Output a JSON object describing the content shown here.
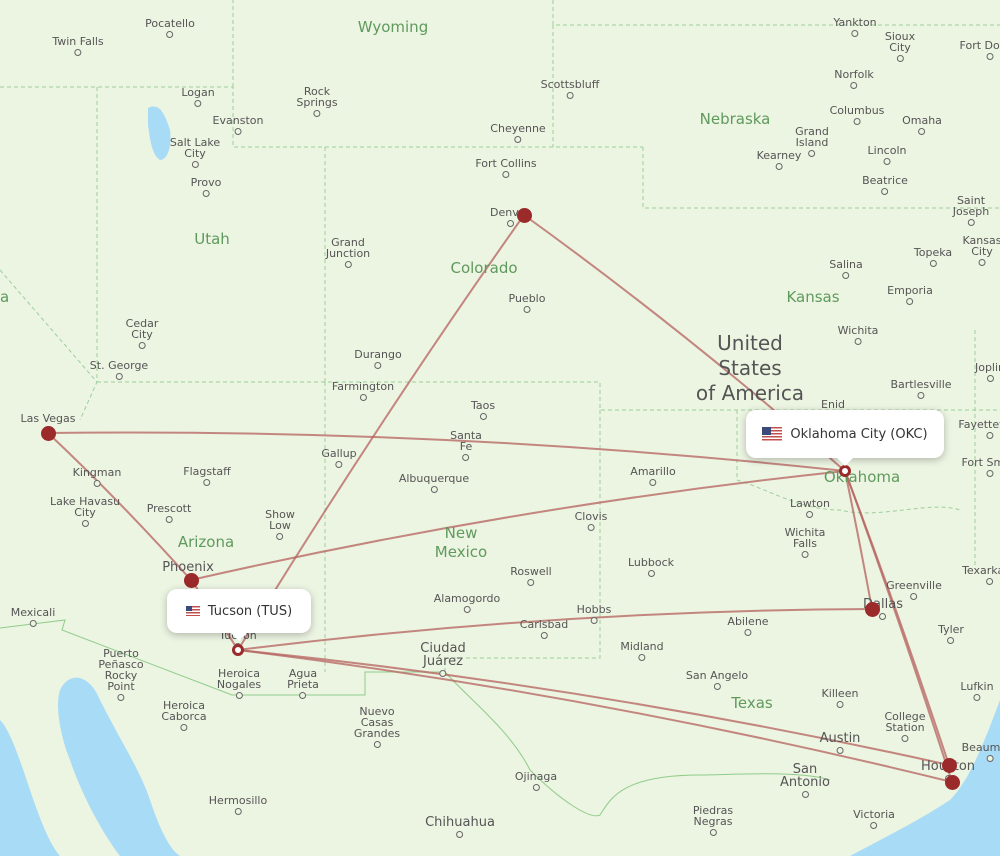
{
  "map": {
    "country_label": [
      "United",
      "States",
      "of America"
    ],
    "state_labels": [
      "Wyoming",
      "Nebraska",
      "Utah",
      "Colorado",
      "Kansas",
      "Arizona",
      "New Mexico",
      "Oklahoma",
      "Texas",
      "Nevada"
    ],
    "cities": [
      "Pocatello",
      "Twin Falls",
      "Logan",
      "Rock Springs",
      "Evanston",
      "Salt Lake City",
      "Provo",
      "Scottsbluff",
      "Cheyenne",
      "Fort Collins",
      "Denver",
      "Yankton",
      "Sioux City",
      "Fort Dodge",
      "Norfolk",
      "Columbus",
      "Omaha",
      "Grand Island",
      "Kearney",
      "Lincoln",
      "Beatrice",
      "Saint Joseph",
      "Kansas City",
      "Topeka",
      "Salina",
      "Emporia",
      "Wichita",
      "Grand Junction",
      "Pueblo",
      "Cedar City",
      "St. George",
      "Durango",
      "Farmington",
      "Taos",
      "Santa Fe",
      "Gallup",
      "Albuquerque",
      "Las Vegas",
      "Kingman",
      "Flagstaff",
      "Lake Havasu City",
      "Prescott",
      "Show Low",
      "Phoenix",
      "Tucson",
      "Mexicali",
      "Puerto Peñasco Rocky Point",
      "Heroica Nogales",
      "Agua Prieta",
      "Heroica Caborca",
      "Hermosillo",
      "Nuevo Casas Grandes",
      "Ciudad Juárez",
      "Chihuahua",
      "Ojinaga",
      "Amarillo",
      "Clovis",
      "Roswell",
      "Alamogordo",
      "Hobbs",
      "Carlsbad",
      "Lubbock",
      "Midland",
      "Abilene",
      "San Angelo",
      "Lawton",
      "Wichita Falls",
      "Enid",
      "Bartlesville",
      "Joplin",
      "Fayetteville",
      "Fort Smith",
      "Greenville",
      "Dallas",
      "Tyler",
      "Killeen",
      "College Station",
      "Austin",
      "Lufkin",
      "Houston",
      "Beaumont",
      "San Antonio",
      "Victoria",
      "Piedras Negras",
      "Texarkana"
    ],
    "route_color": "#b5615e",
    "marker_color": "#9b2a2a"
  },
  "origin": {
    "label": "Oklahoma City (OKC)",
    "flag": "us-flag-icon"
  },
  "highlight": {
    "label": "Tucson (TUS)",
    "flag": "us-flag-icon"
  },
  "routes": [
    {
      "from": "Tucson",
      "to": "Denver"
    },
    {
      "from": "Tucson",
      "to": "Dallas"
    },
    {
      "from": "Tucson",
      "to": "Houston (IAH)"
    },
    {
      "from": "Tucson",
      "to": "Houston (HOU)"
    },
    {
      "from": "Tucson",
      "to": "Phoenix"
    },
    {
      "from": "Oklahoma City",
      "to": "Denver"
    },
    {
      "from": "Oklahoma City",
      "to": "Las Vegas"
    },
    {
      "from": "Oklahoma City",
      "to": "Phoenix"
    },
    {
      "from": "Oklahoma City",
      "to": "Dallas"
    },
    {
      "from": "Oklahoma City",
      "to": "Houston (IAH)"
    },
    {
      "from": "Oklahoma City",
      "to": "Houston (HOU)"
    },
    {
      "from": "Las Vegas",
      "to": "Phoenix"
    }
  ]
}
